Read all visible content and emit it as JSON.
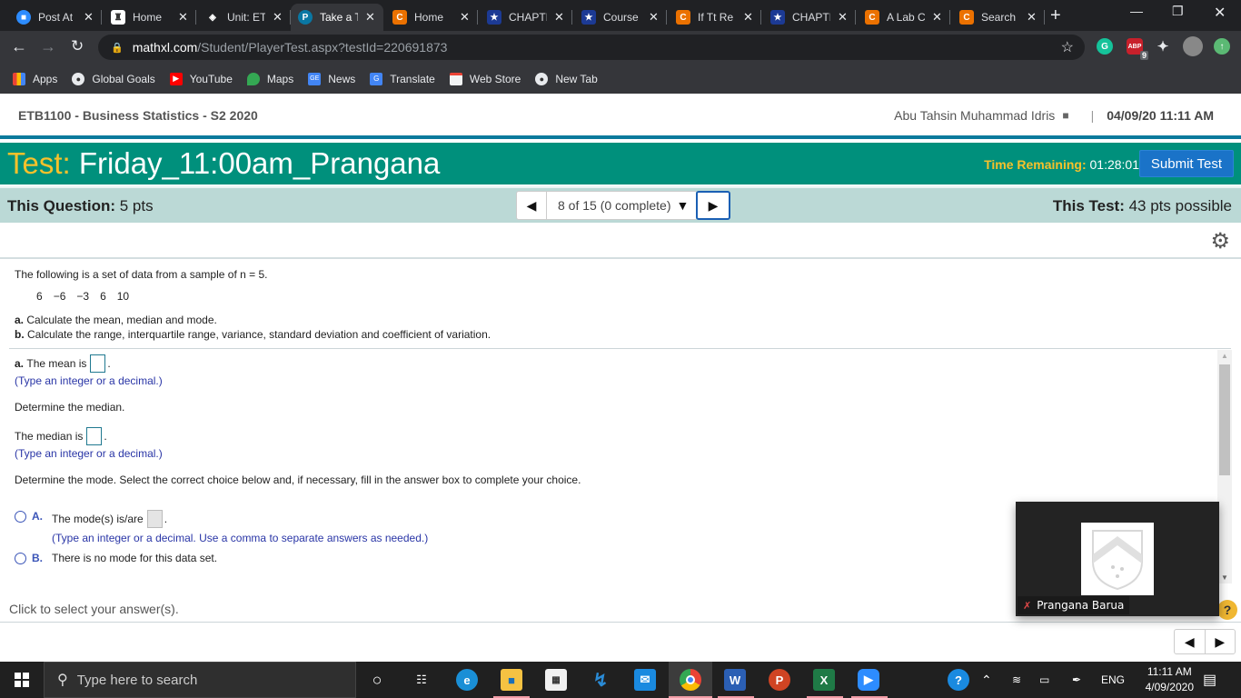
{
  "browser": {
    "tabs": [
      {
        "title": "Post At",
        "icon": "zoom-icon",
        "color": "#2d8cff"
      },
      {
        "title": "Home",
        "icon": "monash-crest-icon",
        "color": "#555555"
      },
      {
        "title": "Unit: ET",
        "icon": "monash-shield-icon",
        "color": "#555555"
      },
      {
        "title": "Take a T",
        "icon": "pearson-icon",
        "color": "#0a77a3",
        "active": true
      },
      {
        "title": "Home",
        "icon": "chegg-icon",
        "color": "#eb7100"
      },
      {
        "title": "CHAPTI",
        "icon": "star-icon",
        "color": "#1c3a94"
      },
      {
        "title": "Course",
        "icon": "star-icon",
        "color": "#1c3a94"
      },
      {
        "title": "If Tt Re",
        "icon": "chegg-icon",
        "color": "#eb7100"
      },
      {
        "title": "CHAPTI",
        "icon": "star-icon",
        "color": "#1c3a94"
      },
      {
        "title": "A Lab C",
        "icon": "chegg-icon",
        "color": "#eb7100"
      },
      {
        "title": "Search",
        "icon": "chegg-icon",
        "color": "#eb7100"
      }
    ],
    "url_host": "mathxl.com",
    "url_path": "/Student/PlayerTest.aspx?testId=220691873",
    "extension_badge": "9",
    "bookmarks": [
      {
        "label": "Apps",
        "icon": "apps-grid-icon"
      },
      {
        "label": "Global Goals",
        "icon": "globe-icon"
      },
      {
        "label": "YouTube",
        "icon": "youtube-icon"
      },
      {
        "label": "Maps",
        "icon": "maps-pin-icon"
      },
      {
        "label": "News",
        "icon": "google-news-icon"
      },
      {
        "label": "Translate",
        "icon": "google-translate-icon"
      },
      {
        "label": "Web Store",
        "icon": "web-store-icon"
      },
      {
        "label": "New Tab",
        "icon": "globe-icon"
      }
    ]
  },
  "header": {
    "course": "ETB1100 - Business Statistics - S2 2020",
    "user": "Abu Tahsin Muhammad Idris",
    "datetime": "04/09/20 11:11 AM"
  },
  "test": {
    "label": "Test:",
    "name": "Friday_11:00am_Prangana",
    "time_label": "Time Remaining:",
    "time_value": "01:28:01",
    "submit_label": "Submit Test"
  },
  "question_bar": {
    "this_question_label": "This Question:",
    "this_question_value": "5 pts",
    "nav_text": "8 of 15 (0 complete)",
    "this_test_label": "This Test:",
    "this_test_value": "43 pts possible"
  },
  "question": {
    "intro": "The following is a set of data from a sample of n = 5.",
    "dataset": [
      "6",
      "−6",
      "−3",
      "6",
      "10"
    ],
    "part_a_label": "a.",
    "part_a_text": "Calculate the mean, median and mode.",
    "part_b_label": "b.",
    "part_b_text": "Calculate the range, interquartile range, variance, standard deviation and coefficient of variation."
  },
  "answer": {
    "mean_prefix_bold": "a.",
    "mean_prefix": "The mean is",
    "mean_value": "",
    "hint_int_decimal": "(Type an integer or a decimal.)",
    "median_prompt": "Determine the median.",
    "median_prefix": "The median is",
    "median_value": "",
    "mode_prompt": "Determine the mode. Select the correct choice below and, if necessary, fill in the answer box to complete your choice.",
    "choices": [
      {
        "letter": "A.",
        "text": "The mode(s) is/are",
        "hint": "(Type an integer or a decimal. Use a comma to separate answers as needed.)"
      },
      {
        "letter": "B.",
        "text": "There is no mode for this data set."
      }
    ]
  },
  "status_text": "Click to select your answer(s).",
  "zoom_overlay": {
    "participant": "Prangana Barua"
  },
  "taskbar": {
    "search_placeholder": "Type here to search",
    "lang": "ENG",
    "time": "11:11 AM",
    "date": "4/09/2020"
  }
}
